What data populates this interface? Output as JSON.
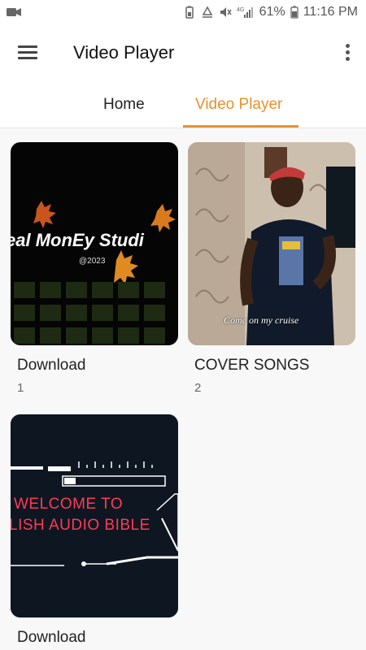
{
  "status_bar": {
    "battery_percent": "61%",
    "time": "11:16 PM",
    "network": "4G",
    "icons": [
      "video-camera-icon",
      "battery-saver-icon",
      "recycle-icon",
      "mute-icon",
      "signal-icon",
      "battery-icon"
    ]
  },
  "app_bar": {
    "title": "Video Player",
    "menu_icon": "hamburger-menu-icon",
    "more_icon": "more-vertical-icon"
  },
  "tabs": [
    {
      "label": "Home",
      "active": false
    },
    {
      "label": "Video Player",
      "active": true
    }
  ],
  "colors": {
    "accent": "#e8912d",
    "background": "#f8f8f8"
  },
  "folders": [
    {
      "title": "Download",
      "count": "1",
      "thumb_text": "eal MonEy Studi",
      "thumb_subtext": "@2023"
    },
    {
      "title": "COVER SONGS",
      "count": "2",
      "thumb_text": "Come on my cruise"
    },
    {
      "title": "Download",
      "thumb_line1": "WELCOME TO",
      "thumb_line2": "LISH AUDIO BIBLE"
    }
  ]
}
